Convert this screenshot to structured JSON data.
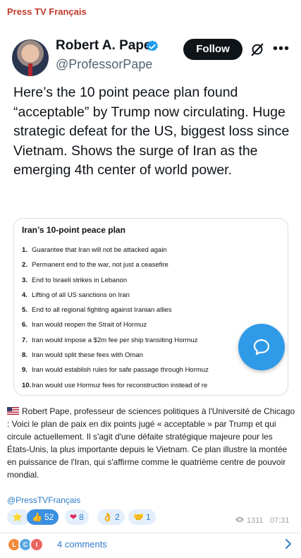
{
  "channel": {
    "name": "Press TV Français"
  },
  "tweet": {
    "author_name": "Robert A. Pape",
    "handle": "@ProfessorPape",
    "follow_label": "Follow",
    "more_label": "•••",
    "text": "Here’s the 10 point peace plan found “acceptable” by Trump now circulating. Huge strategic defeat for the US, biggest loss since Vietnam.  Shows the surge of Iran as the emerging 4th center of world power."
  },
  "plan": {
    "title": "Iran’s 10-point peace plan",
    "items": [
      {
        "num": "1.",
        "text": "Guarantee that Iran will not be attacked again"
      },
      {
        "num": "2.",
        "text": "Permanent end to the war, not just a ceasefire"
      },
      {
        "num": "3.",
        "text": "End to Israeli strikes in Lebanon"
      },
      {
        "num": "4.",
        "text": "Lifting of all US sanctions on Iran"
      },
      {
        "num": "5.",
        "text": "End to all regional fighting against Iranian allies"
      },
      {
        "num": "6.",
        "text": "Iran would reopen the Strait of Hormuz"
      },
      {
        "num": "7.",
        "text": "Iran would impose a $2m fee per ship transiting Hormuz"
      },
      {
        "num": "8.",
        "text": "Iran would split these fees with Oman"
      },
      {
        "num": "9.",
        "text": "Iran would establish rules for safe passage through Hormuz"
      },
      {
        "num": "10.",
        "text": "Iran would use Hormuz fees for reconstruction instead of re"
      }
    ]
  },
  "caption": {
    "text": "Robert Pape, professeur de sciences politiques à l'Université de Chicago : Voici le plan de paix en dix points jugé « acceptable » par Trump et qui circule actuellement. Il s'agit d'une défaite stratégique majeure pour les États-Unis, la plus importante depuis le Vietnam. Ce plan illustre la montée en puissance de l'Iran, qui s'affirme comme le quatrième centre de pouvoir mondial."
  },
  "channel_link": "@PressTVFrançais",
  "reactions": [
    {
      "emoji": "⭐",
      "count": ""
    },
    {
      "emoji": "👍",
      "count": "52"
    },
    {
      "emoji": "❤",
      "count": "8"
    },
    {
      "emoji": "👌",
      "count": "2"
    },
    {
      "emoji": "🤝",
      "count": "1"
    }
  ],
  "meta": {
    "views": "1311",
    "time": "07:31"
  },
  "comments": {
    "label": "4 comments",
    "avatars": [
      {
        "letter": "L",
        "color": "#f08a3c"
      },
      {
        "letter": "C",
        "color": "#5aa7e0"
      },
      {
        "letter": "I",
        "color": "#e8665e"
      }
    ]
  },
  "icons": {
    "verified": "verified-badge-icon",
    "grok": "grok-icon",
    "fab": "chat-bubble-icon",
    "eye": "eye-icon",
    "chevron": "chevron-right-icon"
  },
  "colors": {
    "channel": "#c0392b",
    "link": "#2e7cc7",
    "verified": "#1d9bf0",
    "fab": "#2f9ae8"
  }
}
